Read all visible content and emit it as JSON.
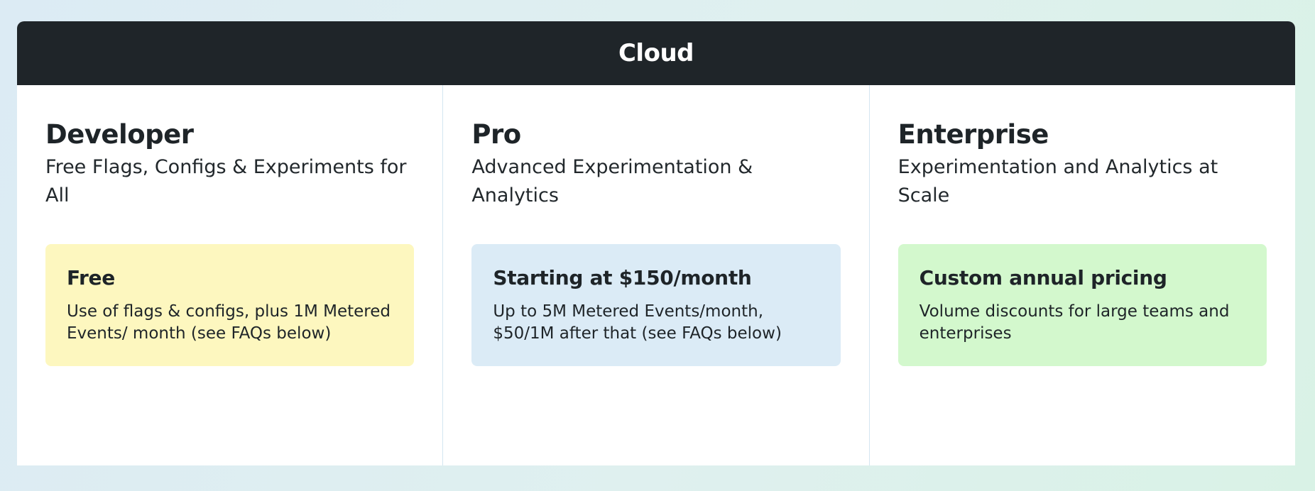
{
  "header": {
    "title": "Cloud"
  },
  "plans": [
    {
      "name": "Developer",
      "description": "Free Flags, Configs & Experiments for All",
      "price_title": "Free",
      "price_text": "Use of flags & configs, plus 1M Metered Events/ month (see FAQs below)",
      "box_color": "#fdf7bf"
    },
    {
      "name": "Pro",
      "description": "Advanced Experimentation & Analytics",
      "price_title": "Starting at $150/month",
      "price_text": "Up to 5M Metered Events/month, $50/1M after that (see FAQs below)",
      "box_color": "#dbebf6"
    },
    {
      "name": "Enterprise",
      "description": "Experimentation and Analytics at Scale",
      "price_title": "Custom annual pricing",
      "price_text": "Volume discounts for large teams and enterprises",
      "box_color": "#d3f8cd"
    }
  ]
}
